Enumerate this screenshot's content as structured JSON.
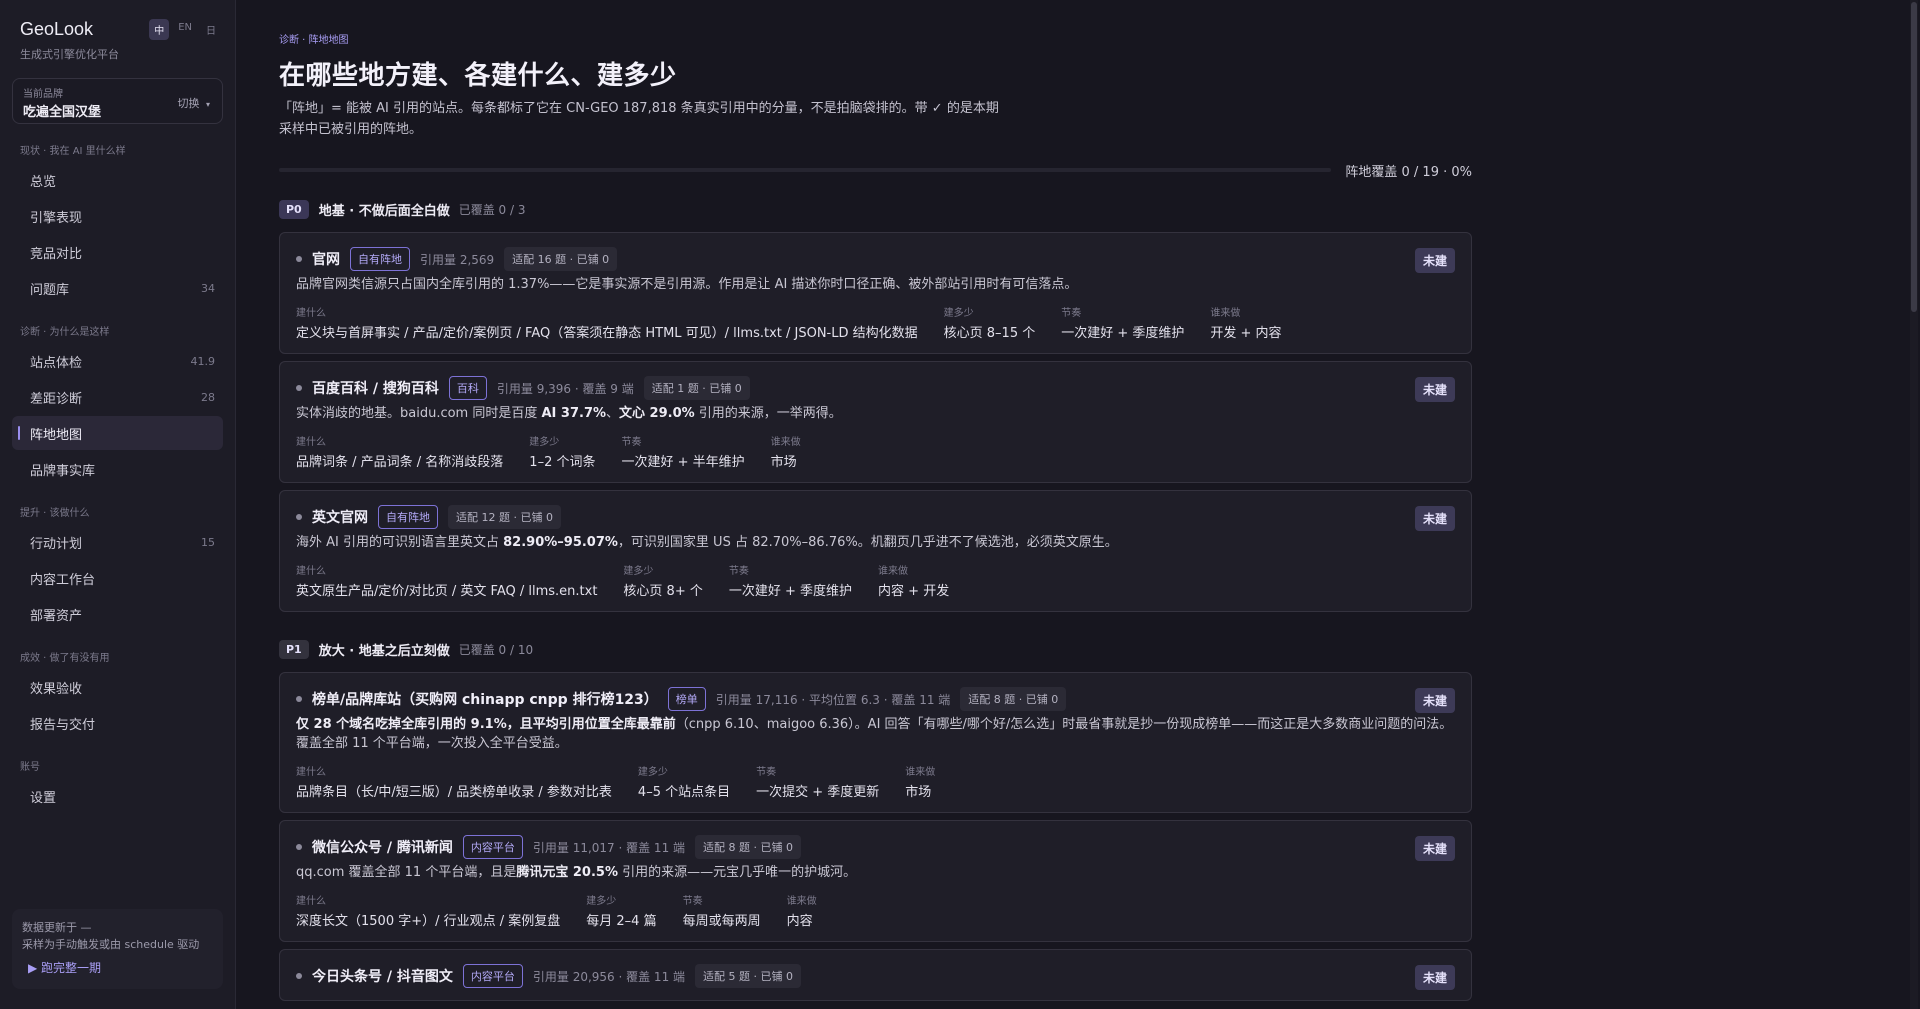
{
  "sidebar": {
    "logo": "GeoLook",
    "languages": [
      "中",
      "EN",
      "日"
    ],
    "tagline": "生成式引擎优化平台",
    "brand_label": "当前品牌",
    "brand_value": "吃遍全国汉堡",
    "brand_switch": "切换",
    "groups": [
      {
        "title": "现状 · 我在 AI 里什么样",
        "items": [
          {
            "label": "总览",
            "count": ""
          },
          {
            "label": "引擎表现",
            "count": ""
          },
          {
            "label": "竞品对比",
            "count": ""
          },
          {
            "label": "问题库",
            "count": "34"
          }
        ]
      },
      {
        "title": "诊断 · 为什么是这样",
        "items": [
          {
            "label": "站点体检",
            "count": "41.9"
          },
          {
            "label": "差距诊断",
            "count": "28"
          },
          {
            "label": "阵地地图",
            "count": "",
            "active": true
          },
          {
            "label": "品牌事实库",
            "count": ""
          }
        ]
      },
      {
        "title": "提升 · 该做什么",
        "items": [
          {
            "label": "行动计划",
            "count": "15"
          },
          {
            "label": "内容工作台",
            "count": ""
          },
          {
            "label": "部署资产",
            "count": ""
          }
        ]
      },
      {
        "title": "成效 · 做了有没有用",
        "items": [
          {
            "label": "效果验收",
            "count": ""
          },
          {
            "label": "报告与交付",
            "count": ""
          }
        ]
      },
      {
        "title": "账号",
        "items": [
          {
            "label": "设置",
            "count": ""
          }
        ]
      }
    ],
    "data_card": {
      "line1": "数据更新于 —",
      "line2": "采样为手动触发或由 schedule 驱动",
      "run": "▶ 跑完整一期"
    }
  },
  "main": {
    "breadcrumb": "诊断 · 阵地地图",
    "title": "在哪些地方建、各建什么、建多少",
    "description": "「阵地」= 能被 AI 引用的站点。每条都标了它在 CN-GEO 187,818 条真实引用中的分量，不是拍脑袋排的。带 ✓ 的是本期采样中已被引用的阵地。",
    "coverage": "阵地覆盖 0 / 19 · 0%",
    "sections": [
      {
        "tier": "P0",
        "title": "地基 · 不做后面全白做",
        "covered": "已覆盖 0 / 3",
        "cards": [
          {
            "name": "官网",
            "tag": "自有阵地",
            "meta": "引用量 2,569",
            "fit": "适配 16 题 · 已铺 0",
            "status": "未建",
            "desc_parts": [
              {
                "t": "品牌官网类信源只占国内全库引用的 1.37%——它是事实源不是引用源。作用是让 AI 描述你时口径正确、被外部站引用时有可信落点。",
                "b": false
              }
            ],
            "fields": [
              {
                "k": "建什么",
                "v": "定义块与首屏事实 / 产品/定价/案例页 / FAQ（答案须在静态 HTML 可见）/ llms.txt / JSON-LD 结构化数据"
              },
              {
                "k": "建多少",
                "v": "核心页 8–15 个"
              },
              {
                "k": "节奏",
                "v": "一次建好 + 季度维护"
              },
              {
                "k": "谁来做",
                "v": "开发 + 内容"
              }
            ]
          },
          {
            "name": "百度百科 / 搜狗百科",
            "tag": "百科",
            "meta": "引用量 9,396 · 覆盖 9 端",
            "fit": "适配 1 题 · 已铺 0",
            "status": "未建",
            "desc_parts": [
              {
                "t": "实体消歧的地基。baidu.com 同时是百度 ",
                "b": false
              },
              {
                "t": "AI 37.7%",
                "b": true
              },
              {
                "t": "、",
                "b": false
              },
              {
                "t": "文心 29.0%",
                "b": true
              },
              {
                "t": " 引用的来源，一举两得。",
                "b": false
              }
            ],
            "fields": [
              {
                "k": "建什么",
                "v": "品牌词条 / 产品词条 / 名称消歧段落"
              },
              {
                "k": "建多少",
                "v": "1–2 个词条"
              },
              {
                "k": "节奏",
                "v": "一次建好 + 半年维护"
              },
              {
                "k": "谁来做",
                "v": "市场"
              }
            ]
          },
          {
            "name": "英文官网",
            "tag": "自有阵地",
            "meta": "",
            "fit": "适配 12 题 · 已铺 0",
            "status": "未建",
            "desc_parts": [
              {
                "t": "海外 AI 引用的可识别语言里英文占 ",
                "b": false
              },
              {
                "t": "82.90%–95.07%",
                "b": true
              },
              {
                "t": "，可识别国家里 US 占 82.70%–86.76%。机翻页几乎进不了候选池，必须英文原生。",
                "b": false
              }
            ],
            "fields": [
              {
                "k": "建什么",
                "v": "英文原生产品/定价/对比页 / 英文 FAQ / llms.en.txt"
              },
              {
                "k": "建多少",
                "v": "核心页 8+ 个"
              },
              {
                "k": "节奏",
                "v": "一次建好 + 季度维护"
              },
              {
                "k": "谁来做",
                "v": "内容 + 开发"
              }
            ]
          }
        ]
      },
      {
        "tier": "P1",
        "title": "放大 · 地基之后立刻做",
        "covered": "已覆盖 0 / 10",
        "cards": [
          {
            "name": "榜单/品牌库站（买购网 chinapp cnpp 排行榜123）",
            "tag": "榜单",
            "meta": "引用量 17,116 · 平均位置 6.3 · 覆盖 11 端",
            "fit": "适配 8 题 · 已铺 0",
            "status": "未建",
            "desc_parts": [
              {
                "t": "仅 28 个域名吃掉全库引用的 9.1%，且平均引用位置全库最靠前",
                "b": true
              },
              {
                "t": "（cnpp 6.10、maigoo 6.36）。AI 回答「有哪些/哪个好/怎么选」时最省事就是抄一份现成榜单——而这正是大多数商业问题的问法。覆盖全部 11 个平台端，一次投入全平台受益。",
                "b": false
              }
            ],
            "fields": [
              {
                "k": "建什么",
                "v": "品牌条目（长/中/短三版）/ 品类榜单收录 / 参数对比表"
              },
              {
                "k": "建多少",
                "v": "4–5 个站点条目"
              },
              {
                "k": "节奏",
                "v": "一次提交 + 季度更新"
              },
              {
                "k": "谁来做",
                "v": "市场"
              }
            ]
          },
          {
            "name": "微信公众号 / 腾讯新闻",
            "tag": "内容平台",
            "meta": "引用量 11,017 · 覆盖 11 端",
            "fit": "适配 8 题 · 已铺 0",
            "status": "未建",
            "desc_parts": [
              {
                "t": "qq.com 覆盖全部 11 个平台端，且是",
                "b": false
              },
              {
                "t": "腾讯元宝 20.5%",
                "b": true
              },
              {
                "t": " 引用的来源——元宝几乎唯一的护城河。",
                "b": false
              }
            ],
            "fields": [
              {
                "k": "建什么",
                "v": "深度长文（1500 字+）/ 行业观点 / 案例复盘"
              },
              {
                "k": "建多少",
                "v": "每月 2–4 篇"
              },
              {
                "k": "节奏",
                "v": "每周或每两周"
              },
              {
                "k": "谁来做",
                "v": "内容"
              }
            ]
          },
          {
            "name": "今日头条号 / 抖音图文",
            "tag": "内容平台",
            "meta": "引用量 20,956 · 覆盖 11 端",
            "fit": "适配 5 题 · 已铺 0",
            "status": "未建",
            "desc_parts": [],
            "fields": []
          }
        ]
      }
    ]
  }
}
